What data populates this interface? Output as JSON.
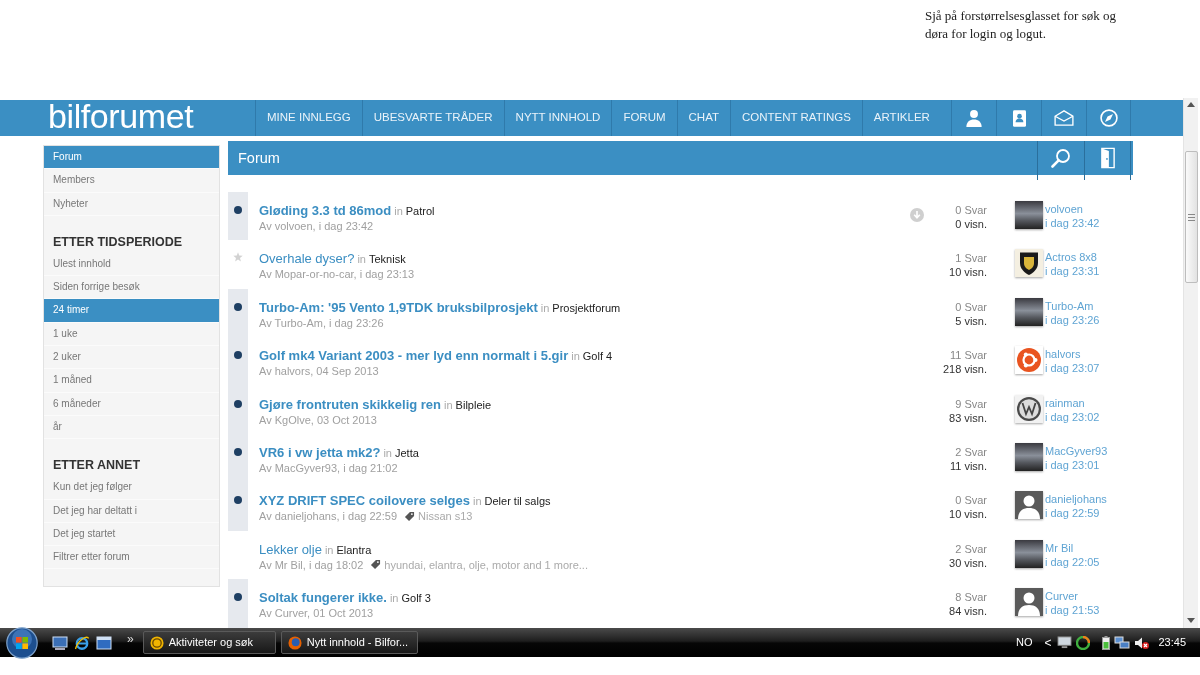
{
  "note": {
    "text": "Sjå på forstørrelsesglasset for søk og døra for login og logut."
  },
  "header": {
    "logo": "bilforumet",
    "nav": [
      {
        "label": "MINE INNLEGG",
        "selected": false
      },
      {
        "label": "UBESVARTE TRÅDER",
        "selected": false
      },
      {
        "label": "NYTT INNHOLD",
        "selected": false
      },
      {
        "label": "FORUM",
        "selected": false
      },
      {
        "label": "CHAT",
        "selected": false
      },
      {
        "label": "CONTENT RATINGS",
        "selected": false
      },
      {
        "label": "ARTIKLER",
        "selected": false
      }
    ]
  },
  "page_title": "Forum",
  "sidebar": {
    "sections": [
      {
        "items": [
          {
            "label": "Forum",
            "selected": true
          },
          {
            "label": "Members",
            "selected": false
          },
          {
            "label": "Nyheter",
            "selected": false
          }
        ]
      },
      {
        "heading": "ETTER TIDSPERIODE",
        "items": [
          {
            "label": "Ulest innhold",
            "selected": false
          },
          {
            "label": "Siden forrige besøk",
            "selected": false
          },
          {
            "label": "24 timer",
            "selected": true
          },
          {
            "label": "1 uke",
            "selected": false
          },
          {
            "label": "2 uker",
            "selected": false
          },
          {
            "label": "1 måned",
            "selected": false
          },
          {
            "label": "6 måneder",
            "selected": false
          },
          {
            "label": "år",
            "selected": false
          }
        ]
      },
      {
        "heading": "ETTER ANNET",
        "items": [
          {
            "label": "Kun det jeg følger",
            "selected": false
          },
          {
            "label": "Det jeg har deltatt i",
            "selected": false
          },
          {
            "label": "Det jeg startet",
            "selected": false
          },
          {
            "label": "Filtrer etter forum",
            "selected": false
          }
        ]
      }
    ]
  },
  "topics": [
    {
      "title": "Gløding 3.3 td 86mod",
      "unread": true,
      "starred": false,
      "in": "in",
      "forum": "Patrol",
      "meta": "Av volvoen, i dag 23:42",
      "jump_button": true,
      "replies": "0 Svar",
      "views": "0 visn.",
      "avatar": {
        "kind": "photo"
      },
      "last_poster": "volvoen",
      "last_time": "i dag 23:42"
    },
    {
      "title": "Overhale dyser?",
      "unread": false,
      "starred": true,
      "in": "in",
      "forum": "Teknisk",
      "meta": "Av Mopar-or-no-car, i dag 23:13",
      "jump_button": false,
      "replies": "1 Svar",
      "views": "10 visn.",
      "avatar": {
        "kind": "shield"
      },
      "last_poster": "Actros 8x8",
      "last_time": "i dag 23:31"
    },
    {
      "title": "Turbo-Am: '95 Vento 1,9TDK bruksbilprosjekt",
      "unread": true,
      "starred": false,
      "in": "in",
      "forum": "Prosjektforum",
      "meta": "Av Turbo-Am, i dag 23:26",
      "jump_button": false,
      "replies": "0 Svar",
      "views": "5 visn.",
      "avatar": {
        "kind": "photo"
      },
      "last_poster": "Turbo-Am",
      "last_time": "i dag 23:26"
    },
    {
      "title": "Golf mk4 Variant 2003 - mer lyd enn normalt i 5.gir",
      "unread": true,
      "starred": false,
      "in": "in",
      "forum": "Golf 4",
      "meta": "Av halvors, 04 Sep 2013",
      "jump_button": false,
      "replies": "11 Svar",
      "views": "218 visn.",
      "avatar": {
        "kind": "ring"
      },
      "last_poster": "halvors",
      "last_time": "i dag 23:07"
    },
    {
      "title": "Gjøre frontruten skikkelig ren",
      "unread": true,
      "starred": false,
      "in": "in",
      "forum": "Bilpleie",
      "meta": "Av KgOlve, 03 Oct 2013",
      "jump_button": false,
      "replies": "9 Svar",
      "views": "83 visn.",
      "avatar": {
        "kind": "round"
      },
      "last_poster": "rainman",
      "last_time": "i dag 23:02"
    },
    {
      "title": "VR6 i vw jetta mk2?",
      "unread": true,
      "starred": false,
      "in": "in",
      "forum": "Jetta",
      "meta": "Av MacGyver93, i dag 21:02",
      "jump_button": false,
      "replies": "2 Svar",
      "views": "11 visn.",
      "avatar": {
        "kind": "photo"
      },
      "last_poster": "MacGyver93",
      "last_time": "i dag 23:01"
    },
    {
      "title": "XYZ DRIFT SPEC coilovere selges",
      "unread": true,
      "starred": false,
      "in": "in",
      "forum": "Deler til salgs",
      "meta": "Av danieljohans, i dag 22:59",
      "tags": "Nissan s13",
      "jump_button": false,
      "replies": "0 Svar",
      "views": "10 visn.",
      "avatar": {
        "kind": "silhouette"
      },
      "last_poster": "danieljohans",
      "last_time": "i dag 22:59"
    },
    {
      "title": "Lekker olje",
      "unread": false,
      "starred": false,
      "in": "in",
      "forum": "Elantra",
      "meta": "Av Mr Bil, i dag 18:02",
      "tags": "hyundai, elantra, olje, motor and 1 more...",
      "jump_button": false,
      "replies": "2 Svar",
      "views": "30 visn.",
      "avatar": {
        "kind": "photo"
      },
      "last_poster": "Mr Bil",
      "last_time": "i dag 22:05"
    },
    {
      "title": "Soltak fungerer ikke.",
      "unread": true,
      "starred": false,
      "in": "in",
      "forum": "Golf 3",
      "meta": "Av Curver, 01 Oct 2013",
      "jump_button": false,
      "replies": "8 Svar",
      "views": "84 visn.",
      "avatar": {
        "kind": "silhouette"
      },
      "last_poster": "Curver",
      "last_time": "i dag 21:53"
    }
  ],
  "taskbar": {
    "overflow": "»",
    "tasks": [
      {
        "label": "Aktiviteter og søk",
        "kind": "app",
        "selected": false
      },
      {
        "label": "Nytt innhold - Bilfor...",
        "kind": "browser",
        "selected": false
      }
    ],
    "language": "NO",
    "tray_toggle": "<",
    "clock": "23:45"
  }
}
